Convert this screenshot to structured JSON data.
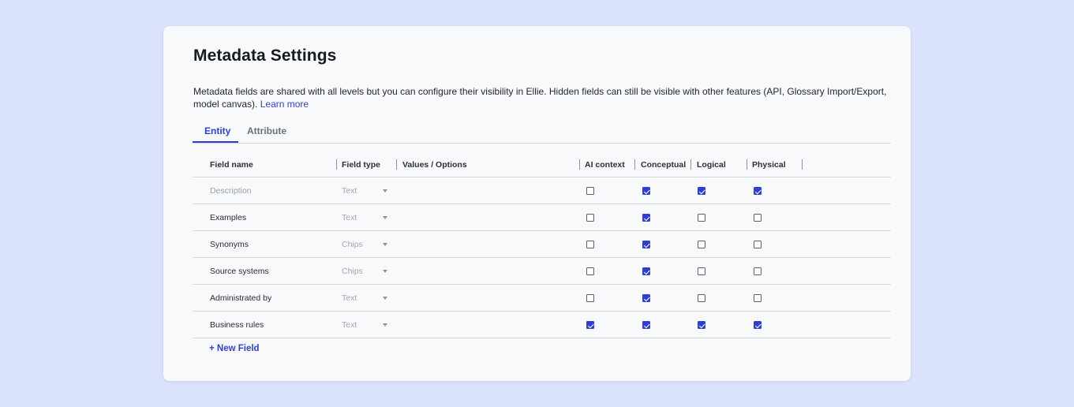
{
  "title": "Metadata Settings",
  "description": "Metadata fields are shared with all levels but you can configure their visibility in Ellie. Hidden fields can still be visible with other features (API, Glossary Import/Export, model canvas).",
  "learn_more": "Learn more",
  "tabs": [
    {
      "label": "Entity",
      "active": true
    },
    {
      "label": "Attribute",
      "active": false
    }
  ],
  "columns": {
    "field_name": "Field name",
    "field_type": "Field type",
    "values": "Values / Options",
    "ai_context": "AI context",
    "conceptual": "Conceptual",
    "logical": "Logical",
    "physical": "Physical"
  },
  "rows": [
    {
      "name": "Description",
      "type": "Text",
      "ai": false,
      "conceptual": true,
      "logical": true,
      "physical": true
    },
    {
      "name": "Examples",
      "type": "Text",
      "ai": false,
      "conceptual": true,
      "logical": false,
      "physical": false
    },
    {
      "name": "Synonyms",
      "type": "Chips",
      "ai": false,
      "conceptual": true,
      "logical": false,
      "physical": false
    },
    {
      "name": "Source systems",
      "type": "Chips",
      "ai": false,
      "conceptual": true,
      "logical": false,
      "physical": false
    },
    {
      "name": "Administrated by",
      "type": "Text",
      "ai": false,
      "conceptual": true,
      "logical": false,
      "physical": false
    },
    {
      "name": "Business rules",
      "type": "Text",
      "ai": true,
      "conceptual": true,
      "logical": true,
      "physical": true
    }
  ],
  "new_field_label": "+ New Field",
  "colors": {
    "accent": "#2f3fd6",
    "background": "#dbe2fd",
    "card": "#f8f9fb"
  }
}
